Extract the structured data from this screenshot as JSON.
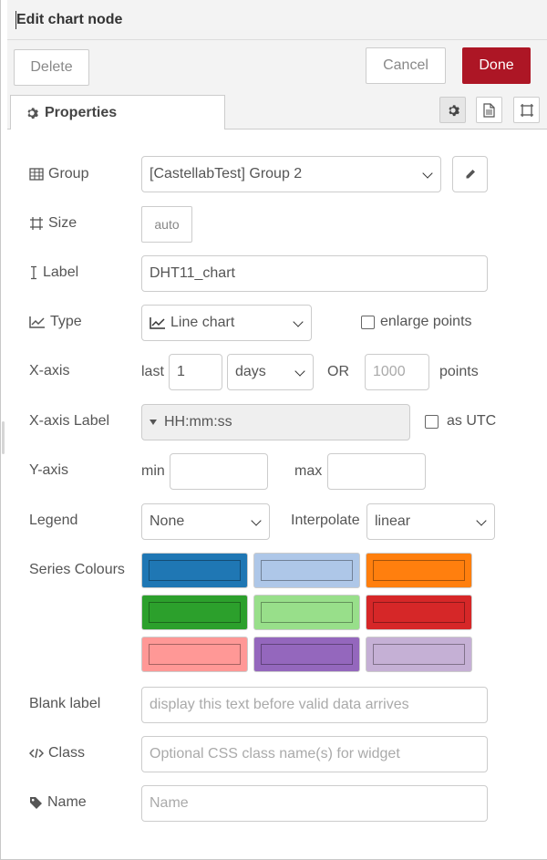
{
  "header": {
    "title": "Edit chart node"
  },
  "toolbar": {
    "delete_label": "Delete",
    "cancel_label": "Cancel",
    "done_label": "Done"
  },
  "tabs": {
    "properties_label": "Properties"
  },
  "form": {
    "group": {
      "label": "Group",
      "value": "[CastellabTest] Group 2"
    },
    "size": {
      "label": "Size",
      "value": "auto"
    },
    "label": {
      "label": "Label",
      "value": "DHT11_chart"
    },
    "type": {
      "label": "Type",
      "value": "Line chart",
      "enlarge_points_label": "enlarge points",
      "enlarge_points_checked": false
    },
    "xaxis": {
      "label": "X-axis",
      "last_label": "last",
      "last_value": "1",
      "unit_value": "days",
      "or_label": "OR",
      "points_placeholder": "1000",
      "points_label": "points"
    },
    "xaxis_label": {
      "label": "X-axis Label",
      "value": "HH:mm:ss",
      "utc_label": "as UTC",
      "utc_checked": false
    },
    "yaxis": {
      "label": "Y-axis",
      "min_label": "min",
      "max_label": "max",
      "min_value": "",
      "max_value": ""
    },
    "legend": {
      "label": "Legend",
      "value": "None",
      "interpolate_label": "Interpolate",
      "interpolate_value": "linear"
    },
    "series_colours": {
      "label": "Series Colours",
      "colors": [
        "#1f77b4",
        "#aec7e8",
        "#ff7f0e",
        "#2ca02c",
        "#98df8a",
        "#d62728",
        "#ff9896",
        "#9467bd",
        "#c5b0d5"
      ]
    },
    "blank_label": {
      "label": "Blank label",
      "placeholder": "display this text before valid data arrives"
    },
    "class": {
      "label": "Class",
      "placeholder": "Optional CSS class name(s) for widget"
    },
    "name": {
      "label": "Name",
      "placeholder": "Name"
    }
  },
  "colors": {
    "done_button": "#ad1625",
    "panel_bg": "#f3f3f3"
  }
}
